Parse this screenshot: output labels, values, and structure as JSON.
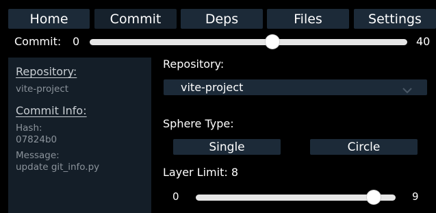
{
  "nav": {
    "tabs": [
      {
        "label": "Home"
      },
      {
        "label": "Commit"
      },
      {
        "label": "Deps"
      },
      {
        "label": "Files"
      },
      {
        "label": "Settings"
      }
    ]
  },
  "commit_slider": {
    "label": "Commit:",
    "min": "0",
    "max": "40",
    "value": 23
  },
  "sidebar": {
    "repository_heading": "Repository:",
    "repository_name": "vite-project",
    "commit_info_heading": "Commit Info:",
    "hash_label": "Hash:",
    "hash_value": "07824b0",
    "message_label": "Message:",
    "message_value": "update git_info.py"
  },
  "settings": {
    "repository_label": "Repository:",
    "repository_selected": "vite-project",
    "sphere_type_label": "Sphere Type:",
    "sphere_options": [
      "Single",
      "Circle"
    ],
    "layer_limit_label": "Layer Limit: 8",
    "layer_slider": {
      "min": "0",
      "max": "9",
      "value": 8
    }
  },
  "icons": {
    "select_chevron": "chevron-down-icon"
  },
  "colors": {
    "background": "#000000",
    "panel": "#141e28",
    "button": "#1c2a38",
    "track": "#e6e6e6",
    "text_muted": "#8b939b"
  }
}
